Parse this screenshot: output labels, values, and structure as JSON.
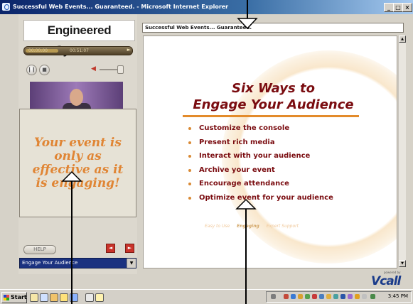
{
  "window": {
    "title": "Successful Web Events... Guaranteed. - Microsoft Internet Explorer",
    "controls": [
      "_",
      "□",
      "×"
    ]
  },
  "sidebar": {
    "logo": "Engineered Systems",
    "player": {
      "position_label": "00:00:00",
      "duration_label": "00:51:07"
    },
    "message": "Your event is only as effective as it is engaging!",
    "help_label": "HELP",
    "nav": {
      "prev": "◄",
      "next": "►"
    },
    "select_value": "Engage Your Audience"
  },
  "address_bar": "Successful Web Events... Guaranteed.",
  "slide": {
    "title_line1": "Six Ways to",
    "title_line2": "Engage Your Audience",
    "bullets": [
      "Customize the console",
      "Present rich media",
      "Interact with your audience",
      "Archive your event",
      "Encourage attendance",
      "Optimize event for your audience"
    ],
    "tabs": [
      "Easy to Use",
      "Engaging",
      "Expert Support"
    ],
    "active_tab": "Engaging"
  },
  "brand": {
    "small": "powered by",
    "big": "Vcall"
  },
  "taskbar": {
    "start_label": "Start",
    "clock": "3:45 PM"
  },
  "colors": {
    "title_red": "#7a0c10",
    "accent_orange": "#e38b2b",
    "message_orange": "#e08534"
  }
}
